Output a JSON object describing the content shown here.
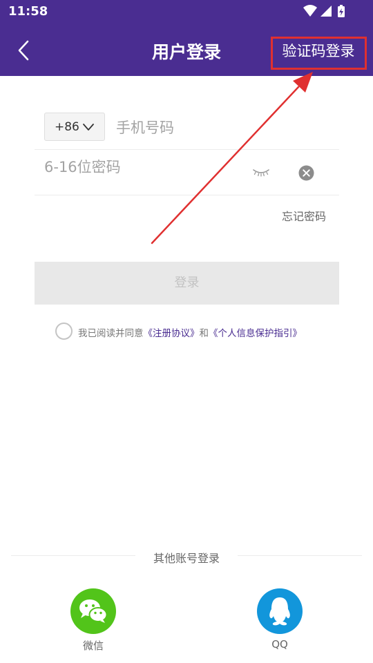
{
  "status_bar": {
    "time": "11:58",
    "icons": [
      "wifi-icon",
      "signal-icon",
      "battery-charging-icon"
    ]
  },
  "header": {
    "title": "用户登录",
    "back_icon": "chevron-left-icon",
    "sms_login_label": "验证码登录"
  },
  "form": {
    "country_code": "+86",
    "phone_placeholder": "手机号码",
    "phone_value": "",
    "password_placeholder": "6-16位密码",
    "password_value": "",
    "eye_icon": "eye-closed-icon",
    "clear_icon": "clear-circle-icon",
    "forgot_label": "忘记密码",
    "login_label": "登录"
  },
  "agreement": {
    "prefix": "我已阅读并同意",
    "terms_link": "《注册协议》",
    "conjunction": "和",
    "privacy_link": "《个人信息保护指引》",
    "checked": false
  },
  "other_login": {
    "title": "其他账号登录",
    "options": [
      {
        "label": "微信",
        "icon": "wechat-icon",
        "color": "#52c41a"
      },
      {
        "label": "QQ",
        "icon": "qq-icon",
        "color": "#1296db"
      }
    ]
  },
  "annotation": {
    "highlight_color": "#e03030",
    "arrow_color": "#e03030"
  },
  "theme": {
    "header_bg": "#4a2d91",
    "link_color": "#4a2d91"
  }
}
